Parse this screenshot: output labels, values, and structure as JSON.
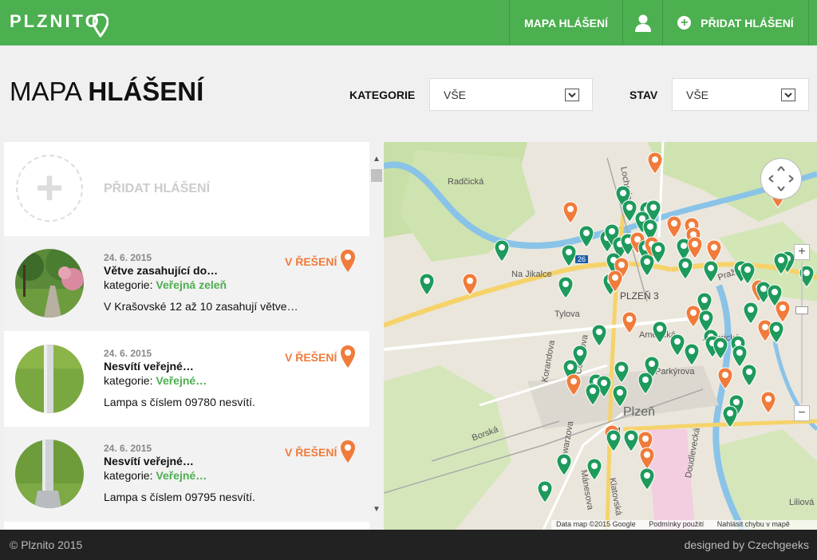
{
  "header": {
    "logo": "PLZNITO",
    "nav_map": "MAPA HLÁŠENÍ",
    "nav_add": "PŘIDAT HLÁŠENÍ",
    "brand_color": "#4caf50"
  },
  "title": {
    "light": "MAPA ",
    "bold": "HLÁŠENÍ"
  },
  "filters": {
    "category_label": "KATEGORIE",
    "category_value": "VŠE",
    "state_label": "STAV",
    "state_value": "VŠE"
  },
  "list": {
    "add_label": "PŘIDAT HLÁŠENÍ",
    "items": [
      {
        "date": "24. 6. 2015",
        "title": "Větve zasahující do…",
        "category_prefix": "kategorie: ",
        "category": "Veřejná zeleň",
        "status": "V ŘEŠENÍ",
        "description": "V Krašovské 12 až 10 zasahují větve…",
        "thumb": "park-path"
      },
      {
        "date": "24. 6. 2015",
        "title": "Nesvítí veřejné…",
        "category_prefix": "kategorie: ",
        "category": "Veřejné…",
        "status": "V ŘEŠENÍ",
        "description": "Lampa s číslem 09780 nesvítí.",
        "thumb": "lamp-post"
      },
      {
        "date": "24. 6. 2015",
        "title": "Nesvítí veřejné…",
        "category_prefix": "kategorie: ",
        "category": "Veřejné…",
        "status": "V ŘEŠENÍ",
        "description": "Lampa s číslem 09795 nesvítí.",
        "thumb": "lamp-post"
      }
    ]
  },
  "map": {
    "labels": {
      "radcicka": "Radčická",
      "na_jikalce": "Na Jikalce",
      "lochotinska": "Lochotínská",
      "plzen3": "PLZEŇ 3",
      "plzen": "Plzeň",
      "americka1": "Americká",
      "americka2": "Americká",
      "tylova": "Tylova",
      "korandova": "Korandova",
      "cernikova": "Černíkova",
      "schwarzova": "Schwarzova",
      "manesova": "Mánesova",
      "borska": "Borská",
      "doudlevecka": "Doudlevecká",
      "liliova": "Liliová",
      "prazska": "Pražská",
      "parkyrova": "Parkýrova",
      "klatovska": "Klatovská",
      "route26": "26",
      "route27": "27"
    },
    "footer_data": "Data map ©2015 Google",
    "footer_terms": "Podmínky použití",
    "footer_report": "Nahlásit chybu v mapě",
    "pin_green": "#1e9a5c",
    "pin_orange": "#f07b3a"
  },
  "footer": {
    "copyright": "© Plznito 2015",
    "designer": "designed by Czechgeeks"
  }
}
